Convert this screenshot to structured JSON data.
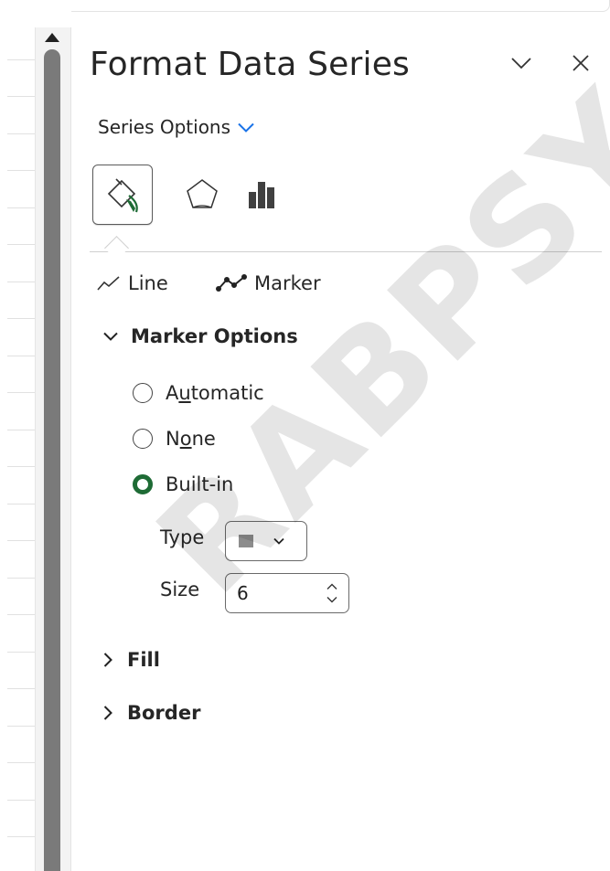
{
  "pane": {
    "title": "Format Data Series",
    "series_options_label": "Series Options"
  },
  "subtabs": {
    "line_label": "Line",
    "marker_label": "Marker"
  },
  "marker_options": {
    "section_title": "Marker Options",
    "radio_automatic_pre": "A",
    "radio_automatic_acc": "u",
    "radio_automatic_post": "tomatic",
    "radio_none_pre": "N",
    "radio_none_acc": "o",
    "radio_none_post": "ne",
    "radio_builtin": "Built-in",
    "selected": "Built-in",
    "type_label": "Type",
    "size_label": "Size",
    "size_value": "6"
  },
  "sections": {
    "fill": "Fill",
    "border": "Border"
  },
  "watermark": "RABPSYCHO",
  "colors": {
    "accent_blue": "#1a73e8",
    "radio_selected": "#1e6b35",
    "thumb": "#7a7a7a"
  }
}
